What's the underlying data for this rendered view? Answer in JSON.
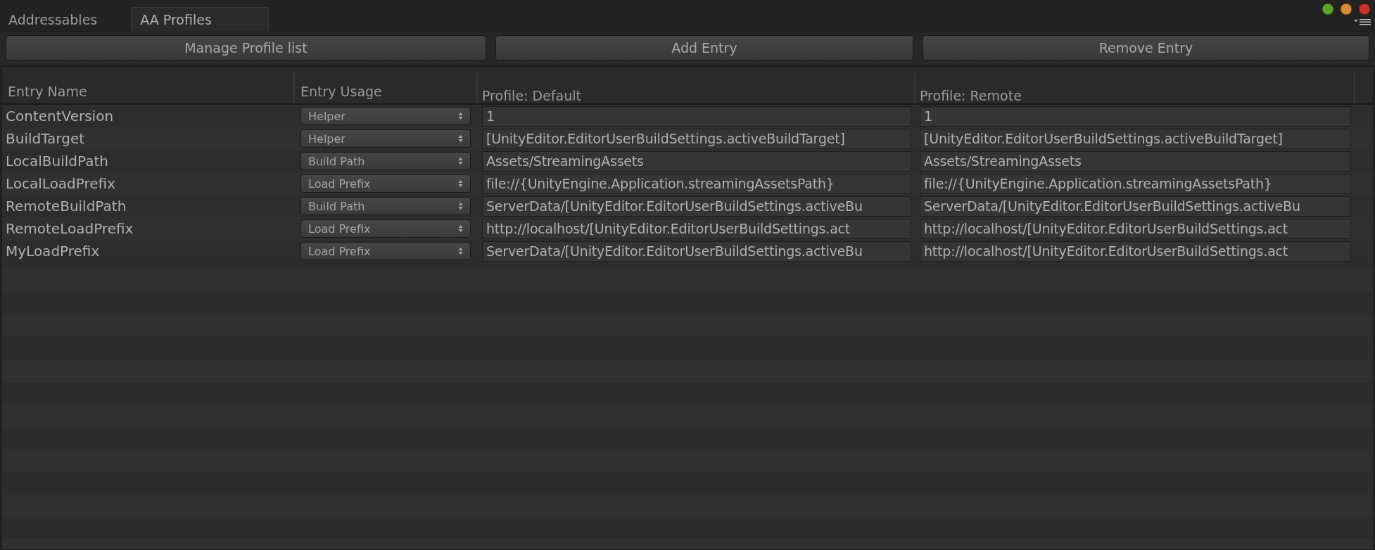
{
  "tabs": [
    {
      "label": "Addressables",
      "selected": false
    },
    {
      "label": "AA Profiles",
      "selected": true
    }
  ],
  "buttons": [
    "Manage Profile list",
    "Add Entry",
    "Remove Entry"
  ],
  "table": {
    "columns": [
      "Entry Name",
      "Entry Usage",
      "Profile: Default",
      "Profile: Remote"
    ],
    "rows": [
      {
        "name": "ContentVersion",
        "usage": "Helper",
        "values": [
          "1",
          "1"
        ]
      },
      {
        "name": "BuildTarget",
        "usage": "Helper",
        "values": [
          "[UnityEditor.EditorUserBuildSettings.activeBuildTarget]",
          "[UnityEditor.EditorUserBuildSettings.activeBuildTarget]"
        ]
      },
      {
        "name": "LocalBuildPath",
        "usage": "Build Path",
        "values": [
          "Assets/StreamingAssets",
          "Assets/StreamingAssets"
        ]
      },
      {
        "name": "LocalLoadPrefix",
        "usage": "Load Prefix",
        "values": [
          "file://{UnityEngine.Application.streamingAssetsPath}",
          "file://{UnityEngine.Application.streamingAssetsPath}"
        ]
      },
      {
        "name": "RemoteBuildPath",
        "usage": "Build Path",
        "values": [
          "ServerData/[UnityEditor.EditorUserBuildSettings.activeBu",
          "ServerData/[UnityEditor.EditorUserBuildSettings.activeBu"
        ]
      },
      {
        "name": "RemoteLoadPrefix",
        "usage": "Load Prefix",
        "values": [
          "http://localhost/[UnityEditor.EditorUserBuildSettings.act",
          "http://localhost/[UnityEditor.EditorUserBuildSettings.act"
        ]
      },
      {
        "name": "MyLoadPrefix",
        "usage": "Load Prefix",
        "values": [
          "ServerData/[UnityEditor.EditorUserBuildSettings.activeBu",
          "http://localhost/[UnityEditor.EditorUserBuildSettings.act"
        ]
      }
    ]
  }
}
